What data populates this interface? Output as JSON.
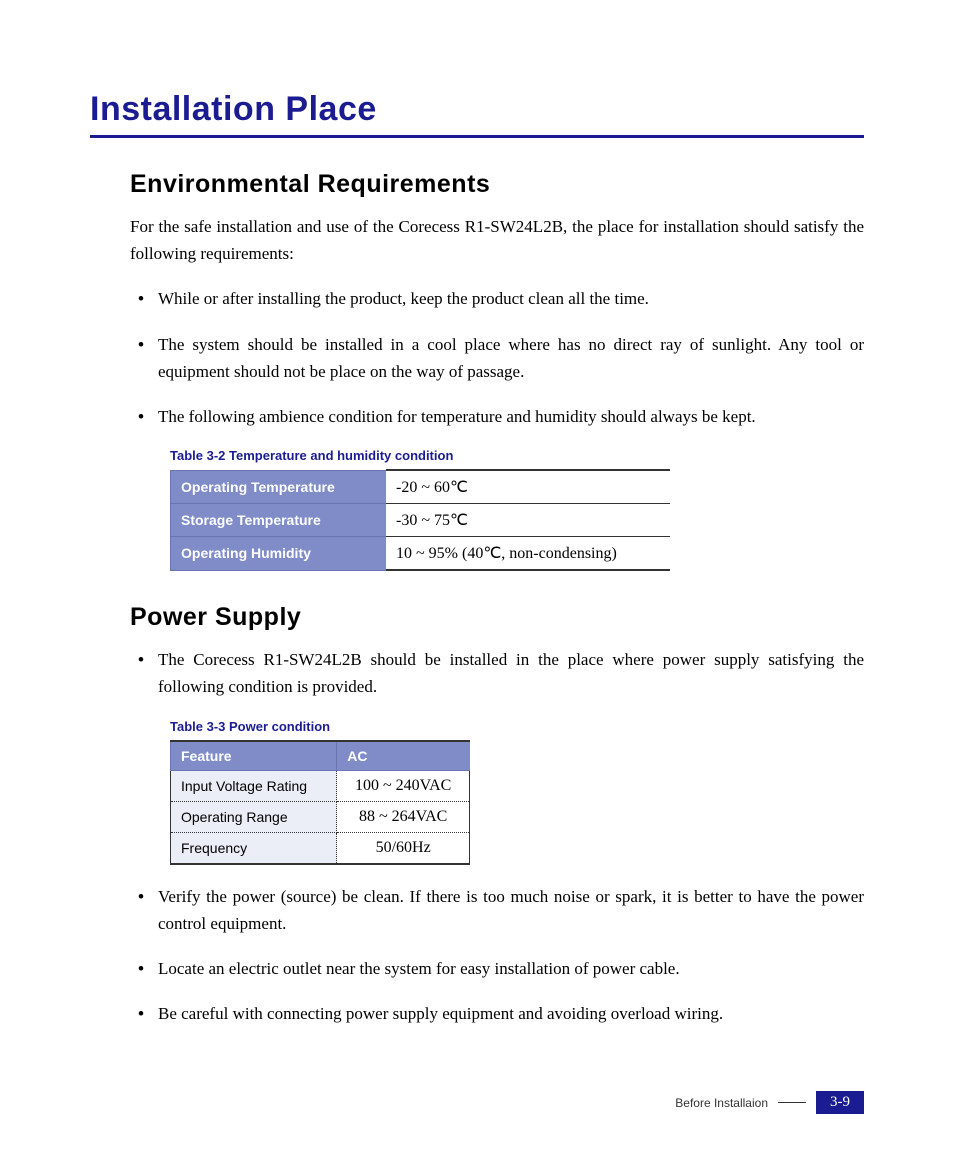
{
  "title": "Installation Place",
  "sections": {
    "env": {
      "heading": "Environmental Requirements",
      "intro": "For the safe installation and use of the Corecess R1-SW24L2B, the place for installation should satisfy the following requirements:",
      "bullets": [
        "While or after installing the product, keep the product clean all the time.",
        "The system should be installed in a cool place where has no direct ray of sunlight. Any tool or equipment should not be place on the way of passage.",
        "The following ambience condition for temperature and humidity should always be kept."
      ],
      "table_caption": "Table 3-2    Temperature and humidity condition",
      "table": [
        {
          "label": "Operating Temperature",
          "value": "-20 ~ 60℃"
        },
        {
          "label": "Storage Temperature",
          "value": "-30 ~ 75℃"
        },
        {
          "label": "Operating Humidity",
          "value": "10 ~ 95% (40℃, non-condensing)"
        }
      ]
    },
    "power": {
      "heading": "Power Supply",
      "bullets_top": [
        "The Corecess R1-SW24L2B should be installed in the place where power supply satisfying the following condition is provided."
      ],
      "table_caption": "Table 3-3    Power condition",
      "table_headers": {
        "feature": "Feature",
        "ac": "AC"
      },
      "table": [
        {
          "feature": "Input Voltage Rating",
          "ac": "100 ~ 240VAC"
        },
        {
          "feature": "Operating Range",
          "ac": "88 ~ 264VAC"
        },
        {
          "feature": "Frequency",
          "ac": "50/60Hz"
        }
      ],
      "bullets_bottom": [
        "Verify the power (source) be clean. If there is too much noise or spark, it is better to have the power control equipment.",
        "Locate an electric outlet near the system for easy installation of power cable.",
        "Be careful with connecting power supply equipment and avoiding overload wiring."
      ]
    }
  },
  "footer": {
    "section": "Before Installaion",
    "page": "3-9"
  }
}
